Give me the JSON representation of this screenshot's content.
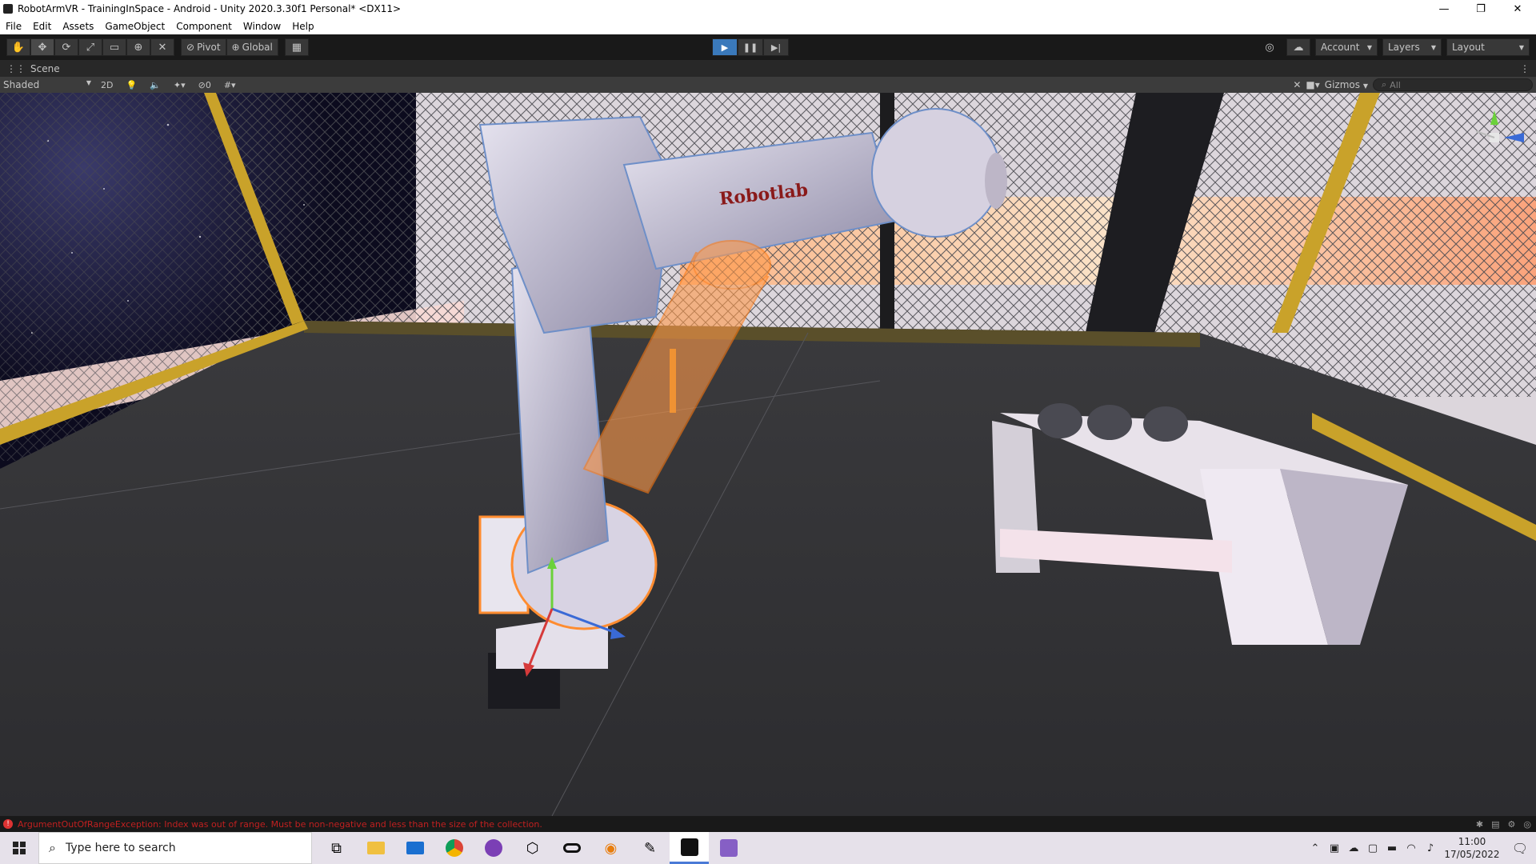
{
  "window": {
    "title": "RobotArmVR - TrainingInSpace - Android - Unity 2020.3.30f1 Personal* <DX11>",
    "minimize": "—",
    "maximize": "❐",
    "close": "✕"
  },
  "menu": [
    "File",
    "Edit",
    "Assets",
    "GameObject",
    "Component",
    "Window",
    "Help"
  ],
  "toolbar": {
    "tools": [
      "✋",
      "✥",
      "⟳",
      "⤢",
      "▭",
      "⊕",
      "✕"
    ],
    "pivot_label": "Pivot",
    "global_label": "Global",
    "grid_icon": "▦",
    "play": "▶",
    "pause": "❚❚",
    "step": "▶|",
    "account_label": "Account",
    "layers_label": "Layers",
    "layout_label": "Layout"
  },
  "scene": {
    "tab_label": "Scene",
    "shading_mode": "Shaded",
    "mode_2d": "2D",
    "hidden_count": "0",
    "gizmos_label": "Gizmos",
    "search_placeholder": "All",
    "robot_text": "Robotlab"
  },
  "status": {
    "error_message": "ArgumentOutOfRangeException: Index was out of range. Must be non-negative and less than the size of the collection."
  },
  "taskbar": {
    "search_placeholder": "Type here to search",
    "time": "11:00",
    "date": "17/05/2022"
  }
}
